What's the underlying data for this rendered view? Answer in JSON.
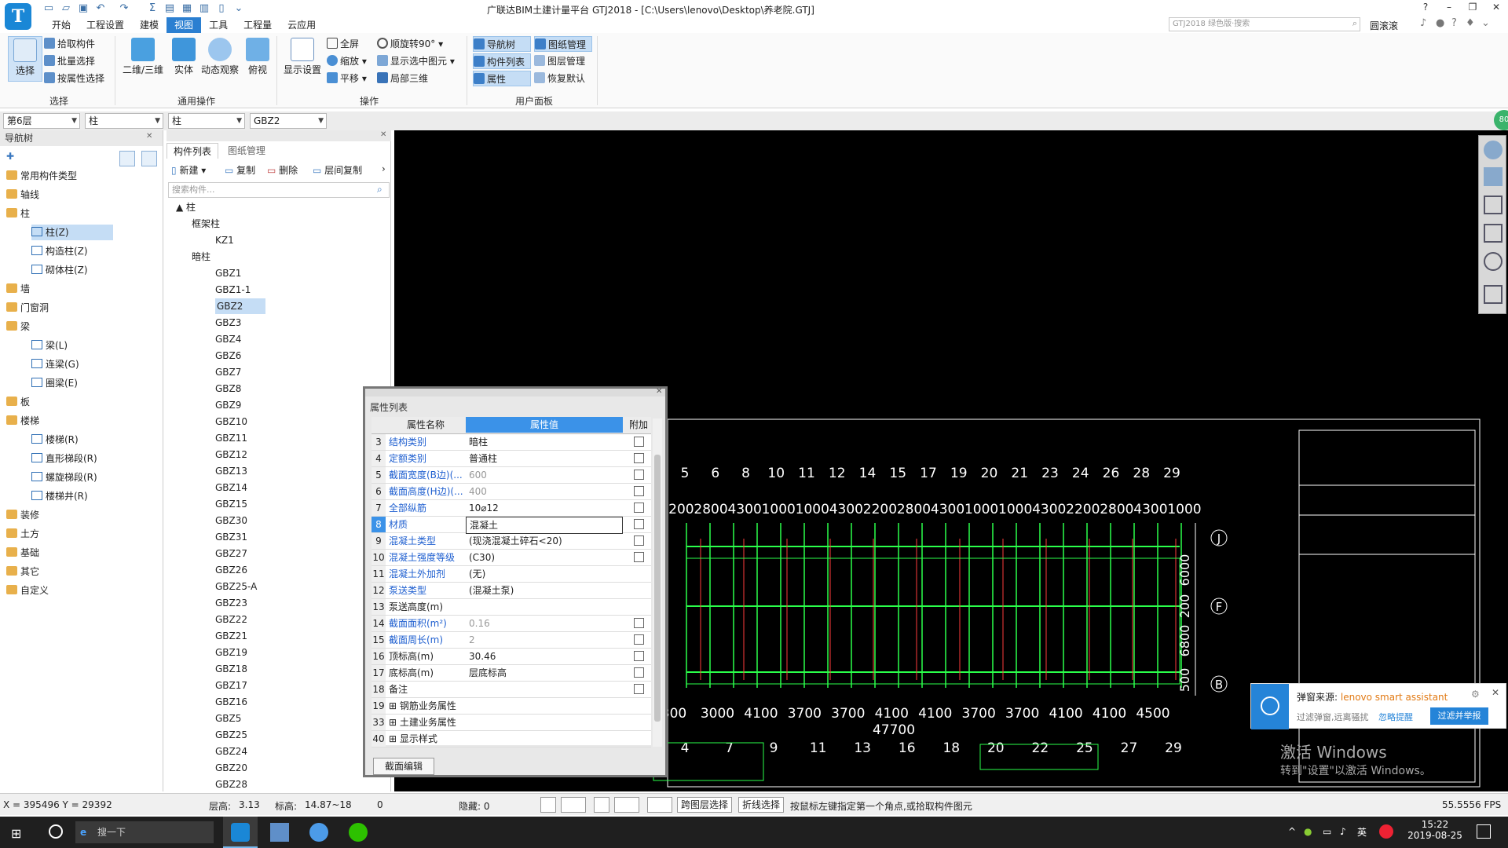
{
  "window": {
    "title": "广联达BIM土建计量平台 GTJ2018 - [C:\\Users\\lenovo\\Desktop\\养老院.GTJ]",
    "search_placeholder": "GTJ2018 绿色版·搜索",
    "user": "圆滚滚"
  },
  "menu": [
    "开始",
    "工程设置",
    "建模",
    "视图",
    "工具",
    "工程量",
    "云应用"
  ],
  "ribbon": {
    "select": {
      "big": "选择",
      "items": [
        "拾取构件",
        "批量选择",
        "按属性选择"
      ],
      "label": "选择"
    },
    "common": {
      "items": [
        "二维/三维",
        "实体",
        "动态观察",
        "俯视"
      ],
      "label": "通用操作"
    },
    "ops": {
      "big": "显示设置",
      "items": [
        "全屏",
        "缩放",
        "平移",
        "顺旋转90°",
        "显示选中图元",
        "局部三维"
      ],
      "label": "操作"
    },
    "panel": {
      "items": [
        "导航树",
        "图纸管理",
        "构件列表",
        "图层管理",
        "属性",
        "恢复默认"
      ],
      "label": "用户面板"
    }
  },
  "dropdowns": [
    "第6层",
    "柱",
    "柱",
    "GBZ2"
  ],
  "nav": {
    "title": "导航树",
    "rows": [
      {
        "t": "常用构件类型",
        "lvl": 0
      },
      {
        "t": "轴线",
        "lvl": 0
      },
      {
        "t": "柱",
        "lvl": 0
      },
      {
        "t": "柱(Z)",
        "lvl": 1,
        "sel": true
      },
      {
        "t": "构造柱(Z)",
        "lvl": 1
      },
      {
        "t": "砌体柱(Z)",
        "lvl": 1
      },
      {
        "t": "墙",
        "lvl": 0
      },
      {
        "t": "门窗洞",
        "lvl": 0
      },
      {
        "t": "梁",
        "lvl": 0
      },
      {
        "t": "梁(L)",
        "lvl": 1
      },
      {
        "t": "连梁(G)",
        "lvl": 1
      },
      {
        "t": "圈梁(E)",
        "lvl": 1
      },
      {
        "t": "板",
        "lvl": 0
      },
      {
        "t": "楼梯",
        "lvl": 0
      },
      {
        "t": "楼梯(R)",
        "lvl": 1
      },
      {
        "t": "直形梯段(R)",
        "lvl": 1
      },
      {
        "t": "螺旋梯段(R)",
        "lvl": 1
      },
      {
        "t": "楼梯井(R)",
        "lvl": 1
      },
      {
        "t": "装修",
        "lvl": 0
      },
      {
        "t": "土方",
        "lvl": 0
      },
      {
        "t": "基础",
        "lvl": 0
      },
      {
        "t": "其它",
        "lvl": 0
      },
      {
        "t": "自定义",
        "lvl": 0
      }
    ]
  },
  "comp": {
    "tabs": [
      "构件列表",
      "图纸管理"
    ],
    "tools": [
      "新建",
      "复制",
      "删除",
      "层间复制"
    ],
    "search": "搜索构件...",
    "root": "柱",
    "g1": "框架柱",
    "g1items": [
      "KZ1"
    ],
    "g2": "暗柱",
    "g2items": [
      "GBZ1",
      "GBZ1-1",
      "GBZ2",
      "GBZ3",
      "GBZ4",
      "GBZ6",
      "GBZ7",
      "GBZ8",
      "GBZ9",
      "GBZ10",
      "GBZ11",
      "GBZ12",
      "GBZ13",
      "GBZ14",
      "GBZ15",
      "GBZ30",
      "GBZ31",
      "GBZ27",
      "GBZ26",
      "GBZ25-A",
      "GBZ23",
      "GBZ22",
      "GBZ21",
      "GBZ19",
      "GBZ18",
      "GBZ17",
      "GBZ16",
      "GBZ5",
      "GBZ25",
      "GBZ24",
      "GBZ20",
      "GBZ28"
    ],
    "selected": "GBZ2"
  },
  "props": {
    "title": "属性列表",
    "h": [
      "属性名称",
      "属性值",
      "附加"
    ],
    "rows": [
      {
        "n": "3",
        "k": "结构类别",
        "v": "暗柱",
        "c": "blue",
        "chk": true
      },
      {
        "n": "4",
        "k": "定额类别",
        "v": "普通柱",
        "c": "blue",
        "chk": true
      },
      {
        "n": "5",
        "k": "截面宽度(B边)(...",
        "v": "600",
        "c": "blue",
        "g": true,
        "chk": true
      },
      {
        "n": "6",
        "k": "截面高度(H边)(...",
        "v": "400",
        "c": "blue",
        "g": true,
        "chk": true
      },
      {
        "n": "7",
        "k": "全部纵筋",
        "v": "10⌀12",
        "c": "blue",
        "chk": true
      },
      {
        "n": "8",
        "k": "材质",
        "v": "混凝土",
        "c": "blue",
        "chk": true,
        "edit": true
      },
      {
        "n": "9",
        "k": "混凝土类型",
        "v": "(现浇混凝土碎石<20)",
        "c": "blue",
        "chk": true
      },
      {
        "n": "10",
        "k": "混凝土强度等级",
        "v": "(C30)",
        "c": "blue",
        "chk": true
      },
      {
        "n": "11",
        "k": "混凝土外加剂",
        "v": "(无)",
        "c": "blue"
      },
      {
        "n": "12",
        "k": "泵送类型",
        "v": "(混凝土泵)",
        "c": "blue"
      },
      {
        "n": "13",
        "k": "泵送高度(m)",
        "v": ""
      },
      {
        "n": "14",
        "k": "截面面积(m²)",
        "v": "0.16",
        "c": "blue",
        "g": true,
        "chk": true
      },
      {
        "n": "15",
        "k": "截面周长(m)",
        "v": "2",
        "c": "blue",
        "g": true,
        "chk": true
      },
      {
        "n": "16",
        "k": "顶标高(m)",
        "v": "30.46",
        "chk": true
      },
      {
        "n": "17",
        "k": "底标高(m)",
        "v": "层底标高",
        "chk": true
      },
      {
        "n": "18",
        "k": "备注",
        "v": "",
        "chk": true
      },
      {
        "n": "19",
        "k": "钢筋业务属性",
        "v": "",
        "plus": true
      },
      {
        "n": "33",
        "k": "土建业务属性",
        "v": "",
        "plus": true
      },
      {
        "n": "40",
        "k": "显示样式",
        "v": "",
        "plus": true
      }
    ],
    "btn": "截面编辑"
  },
  "drawing": {
    "top_axes": [
      "5",
      "6",
      "8",
      "10",
      "11",
      "12",
      "14",
      "15",
      "17",
      "19",
      "20",
      "21",
      "23",
      "24",
      "26",
      "28",
      "29"
    ],
    "top_dims": [
      "2200",
      "2800",
      "4300",
      "1000",
      "1000",
      "4300",
      "2200",
      "2800",
      "4300",
      "1000",
      "1000",
      "4300",
      "2200",
      "2800",
      "4300",
      "1000"
    ],
    "bot_dims": [
      "300",
      "3000",
      "4100",
      "3700",
      "3700",
      "4100",
      "4100",
      "3700",
      "3700",
      "4100",
      "4100",
      "4500"
    ],
    "bot_axes": [
      "4",
      "7",
      "9",
      "11",
      "13",
      "16",
      "18",
      "20",
      "22",
      "25",
      "27",
      "29"
    ],
    "total": "47700",
    "right_axes": [
      "J",
      "F",
      "B"
    ],
    "right_dims": [
      "6000",
      "200",
      "6800",
      "500"
    ]
  },
  "notif": {
    "src_label": "弹窗来源:",
    "src": "lenovo smart assistant",
    "msg": "过滤弹窗,远离骚扰",
    "ignore": "忽略提醒",
    "action": "过滤并举报"
  },
  "watermark": {
    "l1": "激活 Windows",
    "l2": "转到\"设置\"以激活 Windows。"
  },
  "status": {
    "xy": "X = 395496 Y = 29392",
    "floor_h": "层高:",
    "floor_v": "3.13",
    "elev_l": "标高:",
    "elev_v": "14.87~18",
    "zero": "0",
    "hidden": "隐藏: 0",
    "cross": "跨图层选择",
    "poly": "折线选择",
    "hint": "按鼠标左键指定第一个角点,或拾取构件图元",
    "fps": "55.5556 FPS"
  },
  "taskbar": {
    "search": "搜一下",
    "time": "15:22",
    "date": "2019-08-25",
    "ime": "英"
  }
}
